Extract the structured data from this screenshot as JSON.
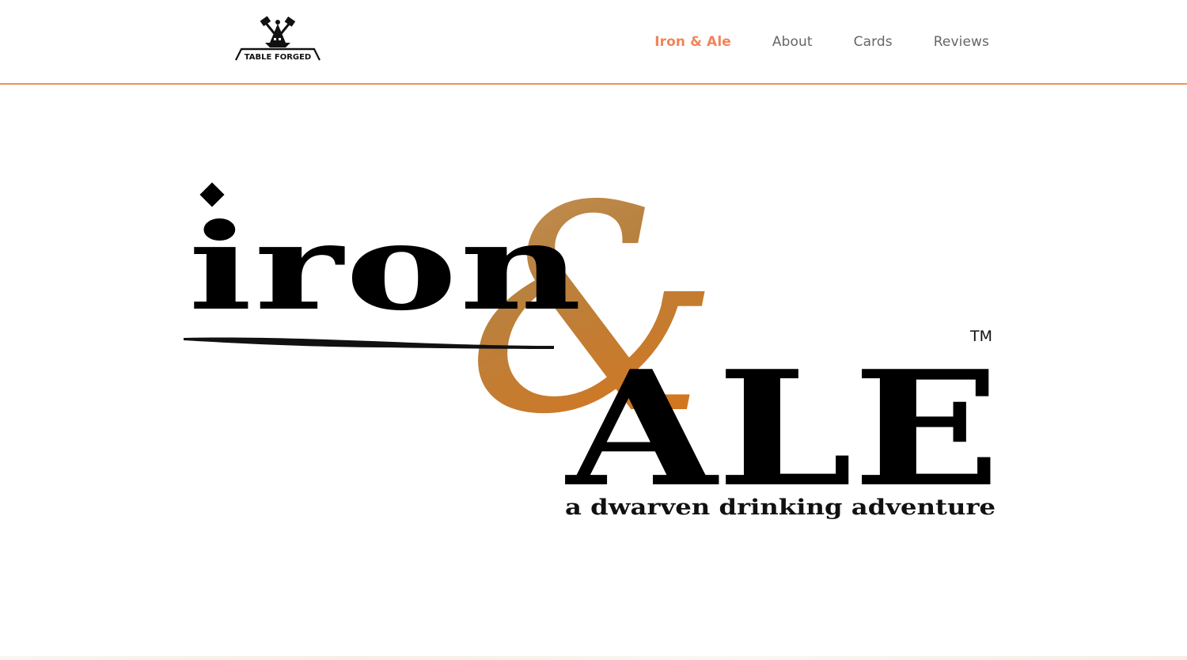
{
  "header": {
    "logo": {
      "text": "TABLE FORGED",
      "icon": "anvil-hammer-icon"
    },
    "nav": [
      {
        "label": "Iron & Ale",
        "active": true
      },
      {
        "label": "About",
        "active": false
      },
      {
        "label": "Cards",
        "active": false
      },
      {
        "label": "Reviews",
        "active": false
      }
    ],
    "accent_color": "#f0855a",
    "divider_color": "#f0915a"
  },
  "hero": {
    "logo_word_1": "iron",
    "ampersand": "&",
    "logo_word_2": "ALE",
    "trademark": "TM",
    "tagline": "a dwarven drinking adventure",
    "ampersand_color": "#c27a3a"
  }
}
